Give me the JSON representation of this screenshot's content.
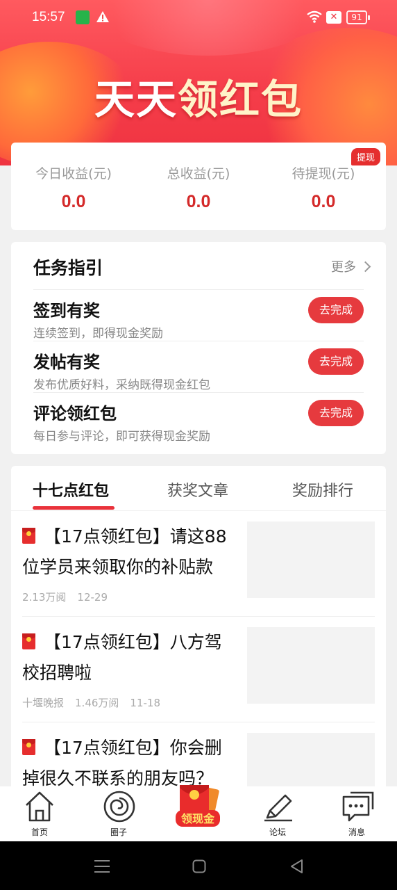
{
  "status_bar": {
    "time": "15:57",
    "battery": "91",
    "sim_label": "1"
  },
  "hero": {
    "title_white": "天天",
    "title_yellow": "领红包"
  },
  "earnings": {
    "badge": "提现",
    "items": [
      {
        "label": "今日收益(元)",
        "value": "0.0"
      },
      {
        "label": "总收益(元)",
        "value": "0.0"
      },
      {
        "label": "待提现(元)",
        "value": "0.0"
      }
    ]
  },
  "tasks": {
    "title": "任务指引",
    "more": "更多",
    "items": [
      {
        "title": "签到有奖",
        "desc": "连续签到，即得现金奖励",
        "button": "去完成"
      },
      {
        "title": "发帖有奖",
        "desc": "发布优质好料，采纳既得现金红包",
        "button": "去完成"
      },
      {
        "title": "评论领红包",
        "desc": "每日参与评论，即可获得现金奖励",
        "button": "去完成"
      }
    ]
  },
  "tabs": [
    {
      "label": "十七点红包",
      "active": true
    },
    {
      "label": "获奖文章",
      "active": false
    },
    {
      "label": "奖励排行",
      "active": false
    }
  ],
  "articles": [
    {
      "title": "【17点领红包】请这88位学员来领取你的补贴款",
      "source": "",
      "views": "2.13万阅",
      "date": "12-29"
    },
    {
      "title": "【17点领红包】八方驾校招聘啦",
      "source": "十堰晚报",
      "views": "1.46万阅",
      "date": "11-18"
    },
    {
      "title": "【17点领红包】你会删掉很久不联系的朋友吗？",
      "source": "",
      "views": "",
      "date": ""
    }
  ],
  "bottom_nav": [
    {
      "label": "首页",
      "icon": "home-icon"
    },
    {
      "label": "圈子",
      "icon": "circle-icon"
    },
    {
      "label": "领现金",
      "icon": "red-envelope-icon"
    },
    {
      "label": "论坛",
      "icon": "pen-icon"
    },
    {
      "label": "消息",
      "icon": "message-icon"
    }
  ],
  "colors": {
    "brand_red": "#e63a3e",
    "value_red": "#d42a2a",
    "title_yellow": "#fff3c8"
  }
}
